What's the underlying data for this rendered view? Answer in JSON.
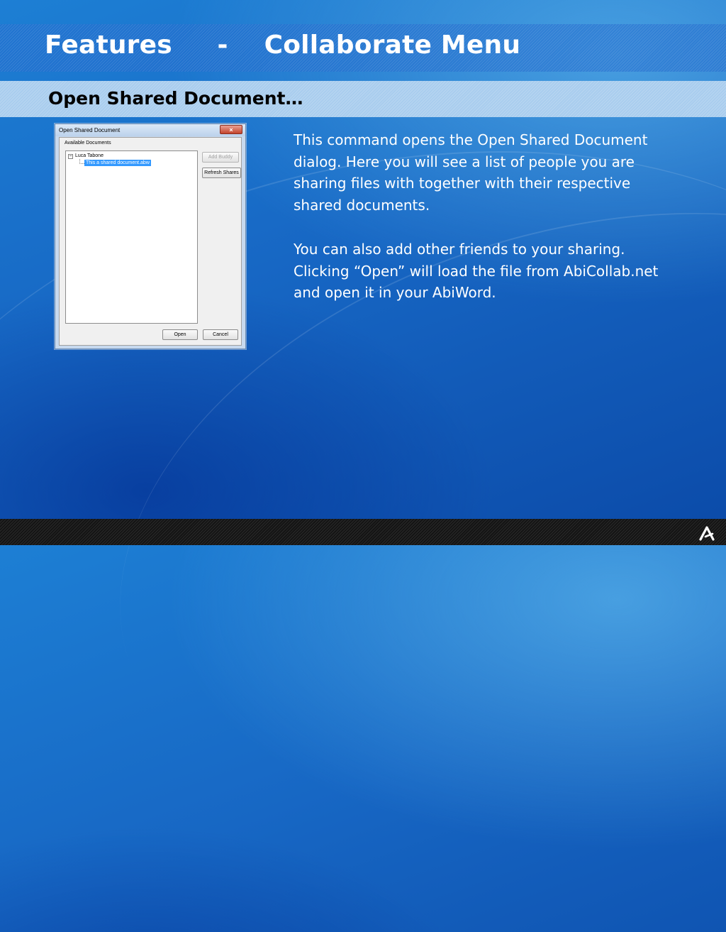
{
  "slide": {
    "title": "Features     -    Collaborate Menu",
    "subtitle": "Open Shared Document…"
  },
  "dialog": {
    "title": "Open Shared Document",
    "close_glyph": "×",
    "group_label": "Available Documents",
    "tree": {
      "expander": "−",
      "buddy": "Luca Tabone",
      "document": "This a shared document.abw"
    },
    "buttons": {
      "add_buddy": "Add Buddy",
      "refresh_shares": "Refresh Shares",
      "open": "Open",
      "cancel": "Cancel"
    }
  },
  "description": {
    "paragraph1": "This command opens the Open Shared Document dialog. Here you will see a list of people you are sharing files with together with their respective shared documents.",
    "paragraph2": "You can also add other friends to your sharing. Clicking “Open” will load the file from AbiCollab.net and open it in your AbiWord."
  },
  "logo": {
    "icon": "abiword-logo-icon"
  }
}
